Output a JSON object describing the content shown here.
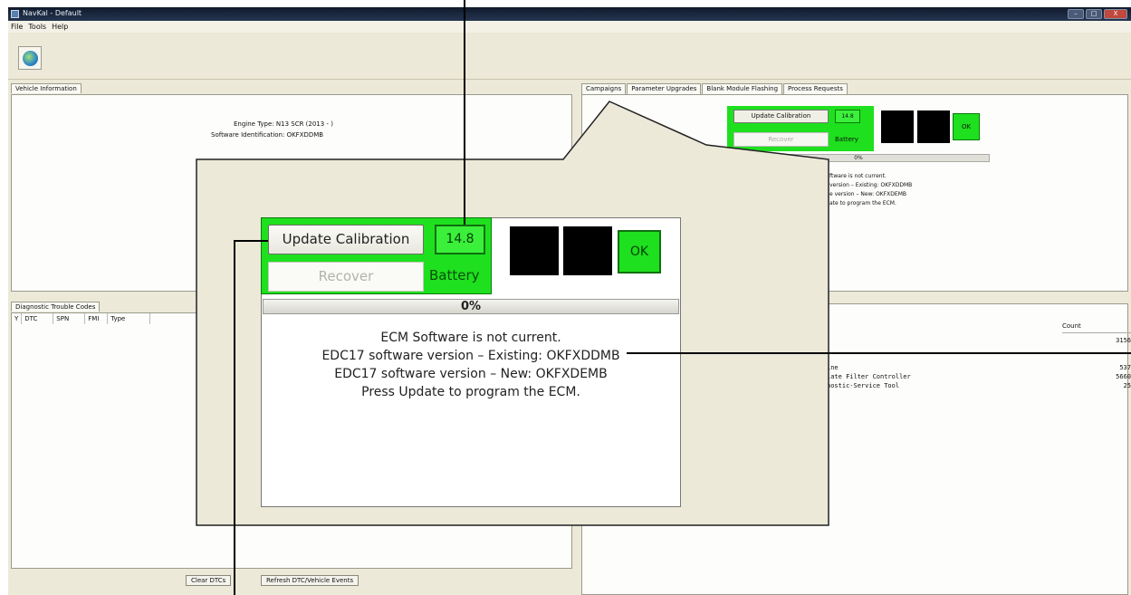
{
  "window": {
    "title": "NavKal - Default",
    "menu": [
      "File",
      "Tools",
      "Help"
    ],
    "controls": {
      "minimize": "–",
      "maximize": "□",
      "close": "X"
    }
  },
  "vehicle_information": {
    "tab_label": "Vehicle Information",
    "engine_type_line": "Engine Type: N13 SCR (2013 - )",
    "software_id_line": "Software Identification: OKFXDDMB"
  },
  "dtc": {
    "tab_label": "Diagnostic Trouble Codes",
    "columns": [
      "Y",
      "DTC",
      "SPN",
      "FMI",
      "Type"
    ],
    "buttons": {
      "clear": "Clear DTCs",
      "refresh": "Refresh DTC/Vehicle Events"
    }
  },
  "right_tabs": [
    "Campaigns",
    "Parameter Upgrades",
    "Blank Module Flashing",
    "Process Requests"
  ],
  "campaign": {
    "update_button": "Update Calibration",
    "voltage": "14.8",
    "recover_button": "Recover",
    "battery_label": "Battery",
    "ok_label": "OK",
    "progress_text": "0%",
    "progress_fraction": 0,
    "messages": [
      "ECM Software is not current.",
      "EDC17 software version – Existing: OKFXDDMB",
      "EDC17 software version – New: OKFXDEMB",
      "Press Update to program the ECM."
    ],
    "small_messages": [
      "ftware is not current.",
      "version – Existing: OKFXDDMB",
      "e version – New: OKFXDEMB",
      "ate to program the ECM."
    ],
    "indicator_colors": {
      "green": "#1ee01e",
      "black": "#000000"
    }
  },
  "counts": {
    "header": "Count",
    "rows": [
      {
        "name": "",
        "count": "3156"
      },
      {
        "name": "ine",
        "count": "537"
      },
      {
        "name": "late Filter Controller",
        "count": "5660"
      },
      {
        "name": "nostic-Service Tool",
        "count": "25"
      }
    ]
  }
}
